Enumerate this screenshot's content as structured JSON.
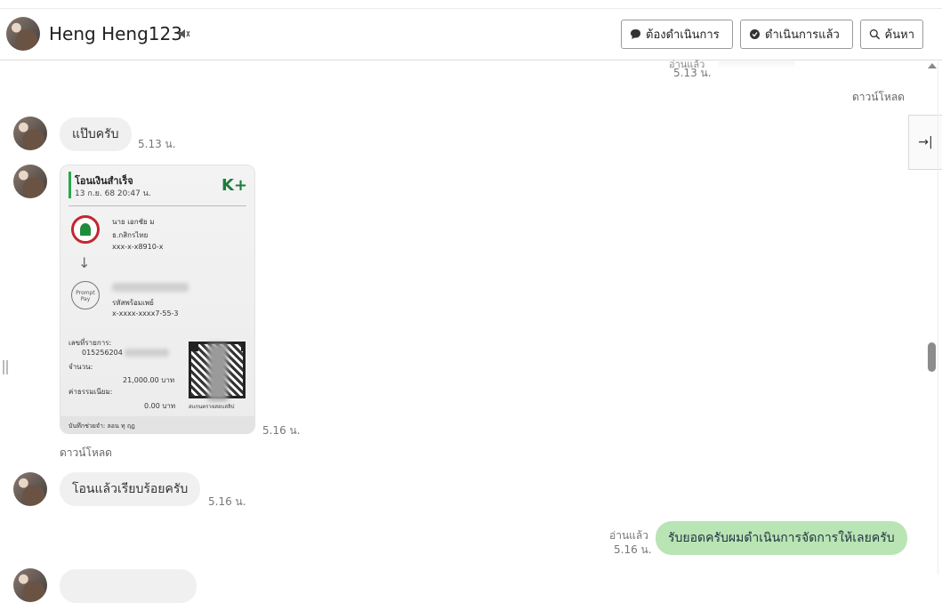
{
  "header": {
    "contact_name": "Heng Heng123",
    "buttons": {
      "todo": "ต้องดำเนินการ",
      "done": "ดำเนินการแล้ว",
      "search": "ค้นหา"
    }
  },
  "messages": {
    "top_cut": {
      "label": "อ่านแล้ว",
      "time": "5.13 น."
    },
    "top_download": "ดาวน์โหลด",
    "m1": {
      "text": "แป๊บครับ",
      "time": "5.13 น."
    },
    "slip": {
      "time": "5.16 น.",
      "download": "ดาวน์โหลด",
      "title": "โอนเงินสำเร็จ",
      "date": "13 ก.ย. 68  20:47 น.",
      "brand": "K+",
      "sender_name": "นาย เอกชัย ม",
      "sender_bank": "ธ.กสิกรไทย",
      "sender_acct": "xxx-x-x8910-x",
      "pp_label": "Prompt Pay",
      "receiver_label": "รหัสพร้อมเพย์",
      "receiver_acct": "x-xxxx-xxxx7-55-3",
      "ref_label": "เลขที่รายการ:",
      "ref_value": "015256204",
      "amount_label": "จำนวน:",
      "amount_value": "21,000.00 บาท",
      "fee_label": "ค่าธรรมเนียม:",
      "fee_value": "0.00 บาท",
      "qr_caption": "สแกนตรวจสอบสลิป",
      "footer": "บันทึกช่วยจำ: ลอน ทุ ฤฎ"
    },
    "m2": {
      "text": "โอนแล้วเรียบร้อยครับ",
      "time": "5.16 น."
    },
    "m3": {
      "read": "อ่านแล้ว",
      "time": "5.16 น.",
      "text": "รับยอดครับผมดำเนินการจัดการให้เลยครับ"
    }
  }
}
